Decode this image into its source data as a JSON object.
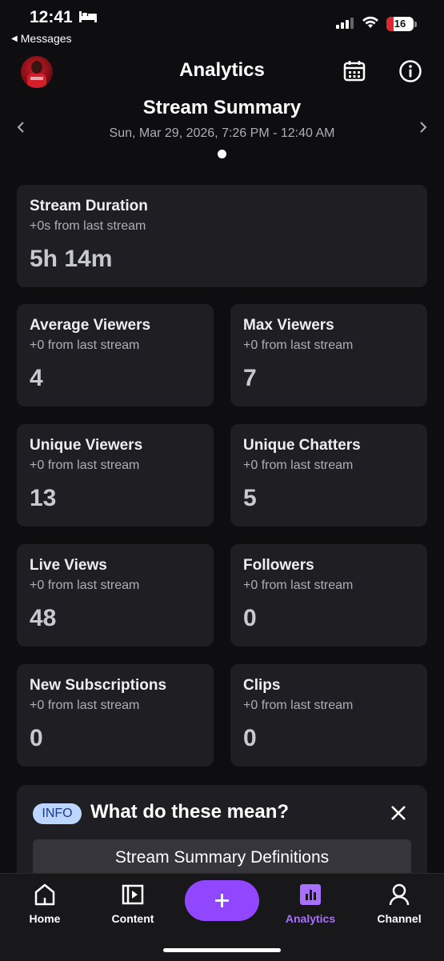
{
  "status_bar": {
    "time": "12:41",
    "back_label": "Messages",
    "battery": "16"
  },
  "header": {
    "title": "Analytics"
  },
  "summary": {
    "title": "Stream Summary",
    "date_range": "Sun, Mar 29, 2026, 7:26 PM - 12:40 AM"
  },
  "stats": {
    "duration": {
      "label": "Stream Duration",
      "change": "+0s from last stream",
      "value": "5h 14m"
    },
    "avg_viewers": {
      "label": "Average Viewers",
      "change": "+0 from last stream",
      "value": "4"
    },
    "max_viewers": {
      "label": "Max Viewers",
      "change": "+0 from last stream",
      "value": "7"
    },
    "unique_viewers": {
      "label": "Unique Viewers",
      "change": "+0 from last stream",
      "value": "13"
    },
    "unique_chatters": {
      "label": "Unique Chatters",
      "change": "+0 from last stream",
      "value": "5"
    },
    "live_views": {
      "label": "Live Views",
      "change": "+0 from last stream",
      "value": "48"
    },
    "followers": {
      "label": "Followers",
      "change": "+0 from last stream",
      "value": "0"
    },
    "new_subs": {
      "label": "New Subscriptions",
      "change": "+0 from last stream",
      "value": "0"
    },
    "clips": {
      "label": "Clips",
      "change": "+0 from last stream",
      "value": "0"
    }
  },
  "info": {
    "badge": "INFO",
    "question": "What do these mean?",
    "button": "Stream Summary Definitions"
  },
  "tabs": {
    "home": "Home",
    "content": "Content",
    "analytics": "Analytics",
    "channel": "Channel"
  },
  "colors": {
    "accent": "#9147ff",
    "active_tab": "#a970ff",
    "card_bg": "#1f1f23",
    "bg": "#0e0e10"
  },
  "icons": [
    "bed-icon",
    "signal-icon",
    "wifi-icon",
    "battery-icon",
    "calendar-icon",
    "info-icon",
    "chevron-left-icon",
    "chevron-right-icon",
    "close-icon",
    "home-icon",
    "content-icon",
    "plus-icon",
    "analytics-icon",
    "channel-icon"
  ]
}
